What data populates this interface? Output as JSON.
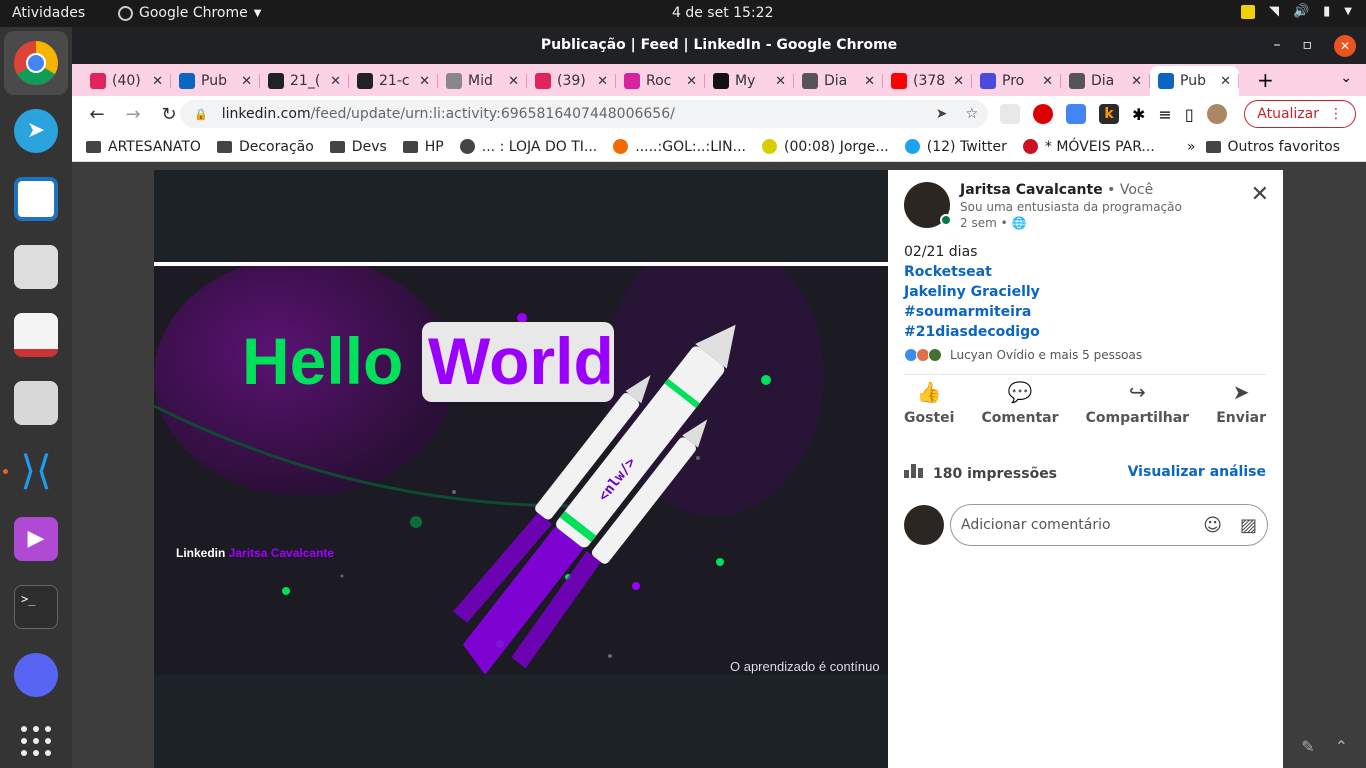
{
  "topbar": {
    "activities": "Atividades",
    "app_name": "Google Chrome",
    "clock": "4 de set  15:22"
  },
  "window": {
    "title": "Publicação | Feed | LinkedIn - Google Chrome"
  },
  "tabs": [
    {
      "label": "(40)",
      "color": "#e0245e"
    },
    {
      "label": "Pub",
      "color": "#0a66c2"
    },
    {
      "label": "21_(",
      "color": "#222222"
    },
    {
      "label": "21-c",
      "color": "#222222"
    },
    {
      "label": "Mid",
      "color": "#888888"
    },
    {
      "label": "(39)",
      "color": "#e0245e"
    },
    {
      "label": "Roc",
      "color": "#d6249f"
    },
    {
      "label": "My",
      "color": "#111111"
    },
    {
      "label": "Dia",
      "color": "#555555"
    },
    {
      "label": "(378",
      "color": "#ff0000"
    },
    {
      "label": "Pro",
      "color": "#4a4ade"
    },
    {
      "label": "Dia",
      "color": "#555555"
    },
    {
      "label": "Pub",
      "color": "#0a66c2",
      "active": true
    }
  ],
  "address": {
    "host": "linkedin.com",
    "path": "/feed/update/urn:li:activity:6965816407448006656/"
  },
  "update_button": "Atualizar",
  "bookmarks": [
    {
      "label": "ARTESANATO",
      "type": "folder"
    },
    {
      "label": "Decoração",
      "type": "folder"
    },
    {
      "label": "Devs",
      "type": "folder"
    },
    {
      "label": "HP",
      "type": "folder"
    },
    {
      "label": "... : LOJA DO TI...",
      "type": "globe"
    },
    {
      "label": ".....:GOL:..:LIN...",
      "type": "ring"
    },
    {
      "label": "(00:08) Jorge...",
      "type": "star"
    },
    {
      "label": "(12) Twitter",
      "type": "twitter"
    },
    {
      "label": "* MÓVEIS PAR...",
      "type": "red"
    }
  ],
  "bookmarks_more": "»",
  "other_favorites": "Outros favoritos",
  "post_image": {
    "hello": "Hello",
    "world": "World",
    "rocket_text": "<nlw/>",
    "footer_left_prefix": "Linkedin ",
    "footer_left_name": "Jaritsa Cavalcante",
    "footer_right": "O aprendizado é contínuo"
  },
  "post": {
    "author": "Jaritsa Cavalcante",
    "you": " • Você",
    "headline": "Sou uma entusiasta da programação",
    "time": "2 sem • ",
    "lines": [
      "02/21 dias"
    ],
    "links": [
      "Rocketseat",
      "Jakeliny Gracielly",
      "#soumarmiteira",
      "#21diasdecodigo"
    ],
    "reactions_text": "Lucyan Ovídio e mais 5 pessoas",
    "actions": [
      {
        "label": "Gostei",
        "icon": "like-icon",
        "glyph": "👍"
      },
      {
        "label": "Comentar",
        "icon": "comment-icon",
        "glyph": "💬"
      },
      {
        "label": "Compartilhar",
        "icon": "share-icon",
        "glyph": "↪"
      },
      {
        "label": "Enviar",
        "icon": "send-icon",
        "glyph": "➤"
      }
    ],
    "impressions": "180 impressões",
    "view_analytics": "Visualizar análise",
    "comment_placeholder": "Adicionar comentário"
  },
  "colors": {
    "accent_green": "#00e05a",
    "accent_purple": "#9b00ff",
    "linkedin_blue": "#0a66c2",
    "update_red": "#c8232c"
  }
}
